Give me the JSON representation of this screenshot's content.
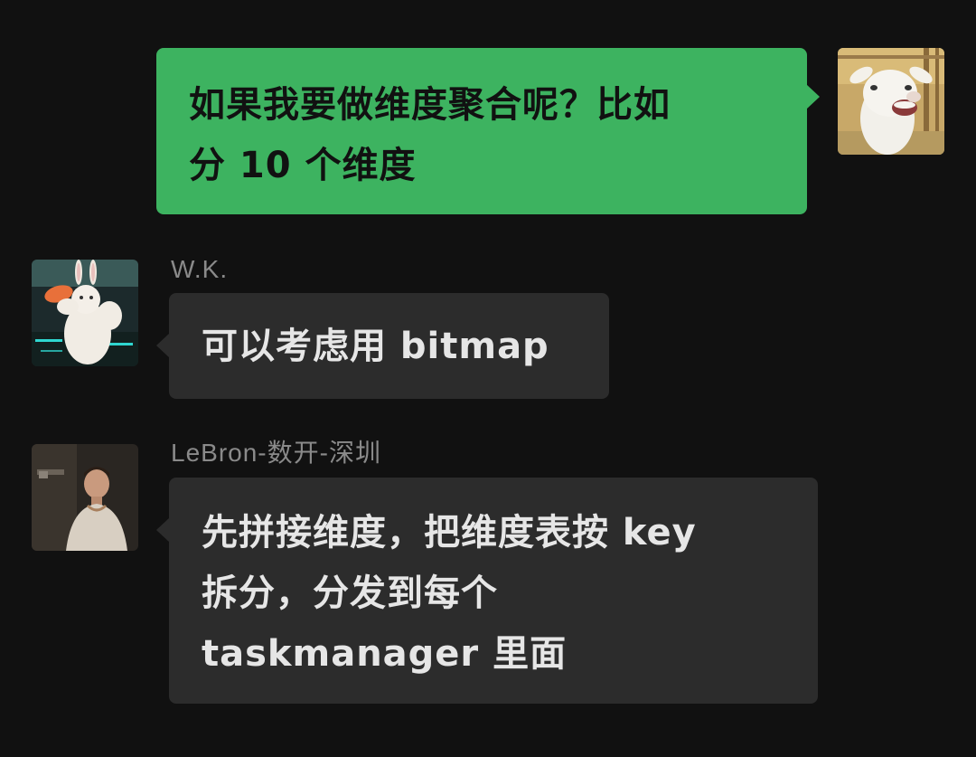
{
  "messages": {
    "outgoing": {
      "lines": [
        "如果我要做维度聚合呢？比如",
        "分 10 个维度"
      ],
      "avatar_icon": "lamb-avatar-icon",
      "bubble_color": "#3db360"
    },
    "wk": {
      "sender": "W.K.",
      "lines": [
        "可以考虑用 bitmap"
      ],
      "avatar_icon": "bunny-avatar-icon",
      "bubble_color": "#2c2c2c"
    },
    "lebron": {
      "sender": "LeBron-数开-深圳",
      "lines": [
        "先拼接维度，把维度表按 key",
        "拆分，分发到每个",
        "taskmanager 里面"
      ],
      "avatar_icon": "person-avatar-icon",
      "bubble_color": "#2c2c2c"
    }
  },
  "colors": {
    "background": "#111111",
    "sender_name": "#8a8a8a",
    "incoming_text": "#e6e6e6",
    "outgoing_text": "#111111"
  }
}
